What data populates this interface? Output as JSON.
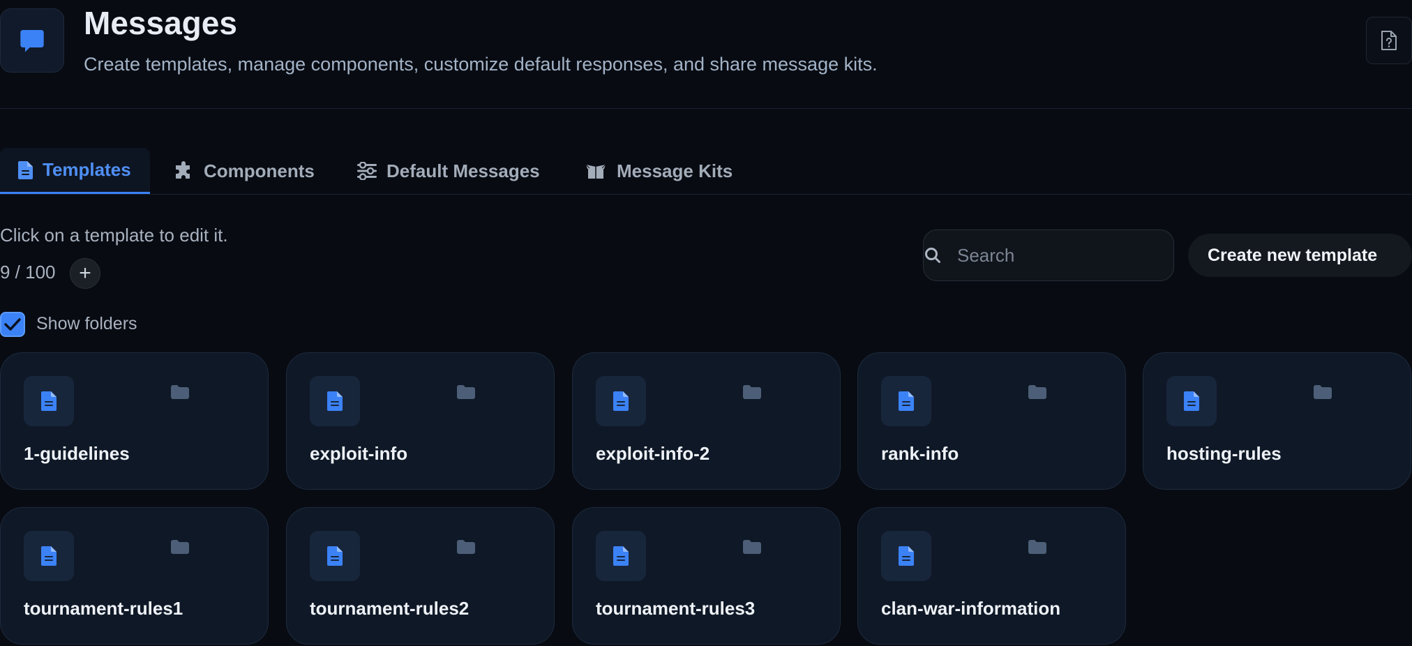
{
  "header": {
    "title": "Messages",
    "subtitle": "Create templates, manage components, customize default responses, and share message kits.",
    "icon": "chat-bubble-icon",
    "help_icon": "file-question-icon"
  },
  "tabs": [
    {
      "label": "Templates",
      "icon": "file-icon",
      "active": true
    },
    {
      "label": "Components",
      "icon": "puzzle-icon",
      "active": false
    },
    {
      "label": "Default Messages",
      "icon": "sliders-icon",
      "active": false
    },
    {
      "label": "Message Kits",
      "icon": "box-open-icon",
      "active": false
    }
  ],
  "toolbar": {
    "hint": "Click on a template to edit it.",
    "count": "9 / 100",
    "add_label": "+",
    "show_folders_label": "Show folders",
    "show_folders_checked": true,
    "search_placeholder": "Search",
    "search_value": "",
    "create_label": "Create new template"
  },
  "templates": [
    {
      "name": "1-guidelines"
    },
    {
      "name": "exploit-info"
    },
    {
      "name": "exploit-info-2"
    },
    {
      "name": "rank-info"
    },
    {
      "name": "hosting-rules"
    },
    {
      "name": "tournament-rules1"
    },
    {
      "name": "tournament-rules2"
    },
    {
      "name": "tournament-rules3"
    },
    {
      "name": "clan-war-information"
    }
  ],
  "colors": {
    "background": "#080b12",
    "accent": "#3b82f6",
    "card_background": "#0f1826",
    "folder_icon": "#4d5f78"
  }
}
